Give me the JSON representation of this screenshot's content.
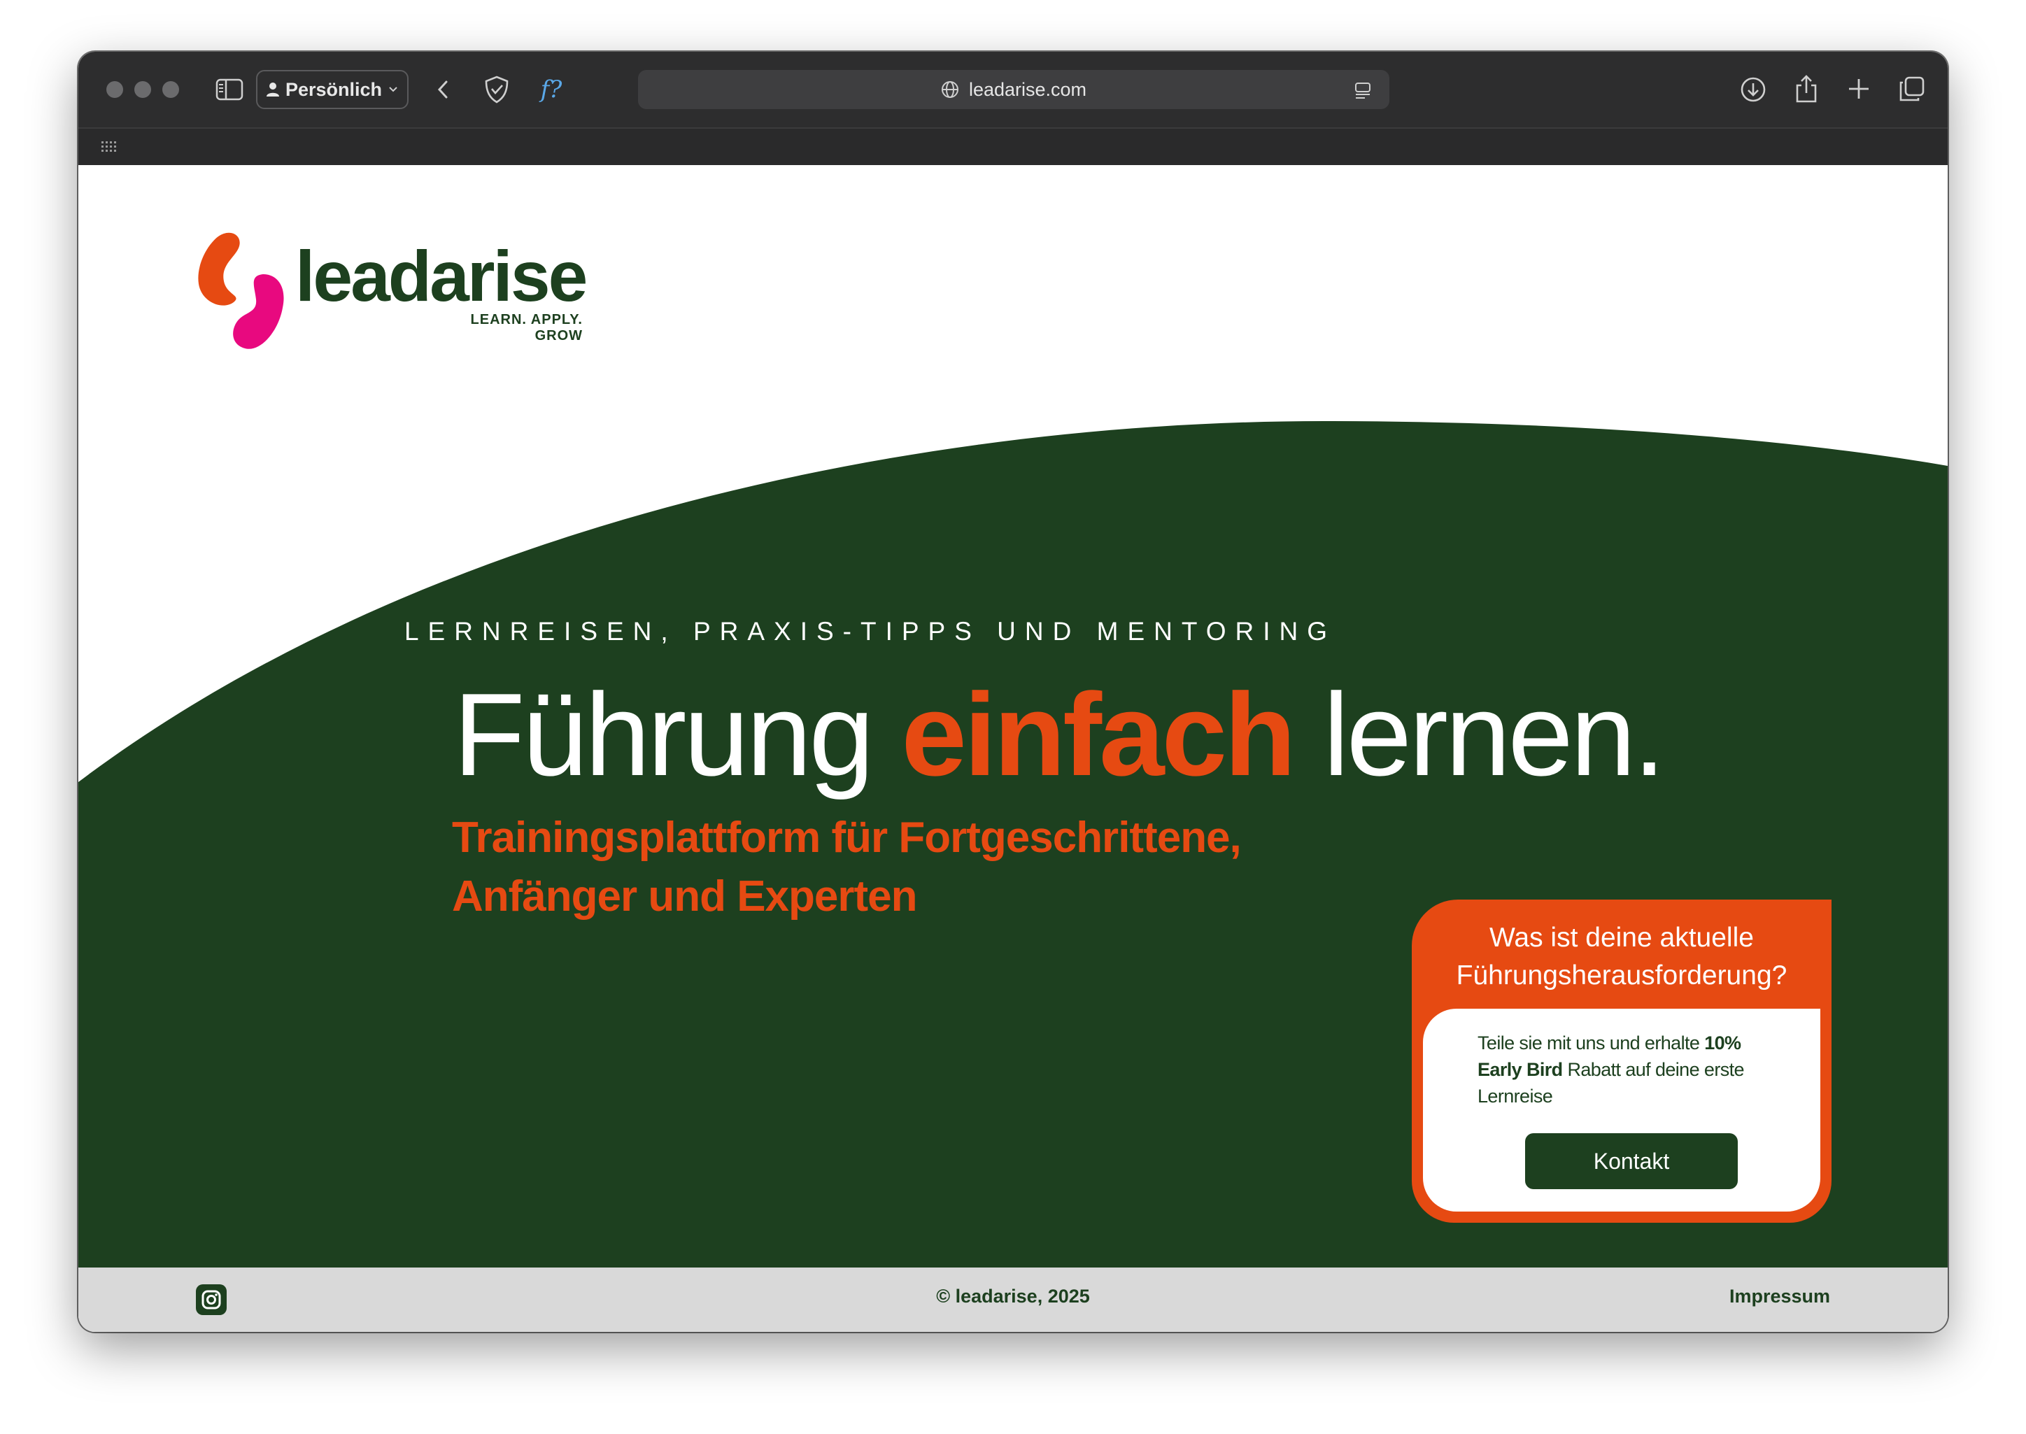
{
  "browser": {
    "profile_label": "Persönlich",
    "url": "leadarise.com",
    "formula_glyph": "f?"
  },
  "logo": {
    "wordmark": "leadarise",
    "tagline": "LEARN. APPLY. GROW"
  },
  "hero": {
    "eyebrow": "LERNREISEN, PRAXIS-TIPPS UND MENTORING",
    "headline_pre": "Führung ",
    "headline_accent": "einfach",
    "headline_post": " lernen.",
    "subline_1": "Trainingsplattform für Fortgeschrittene,",
    "subline_2": "Anfänger und Experten"
  },
  "cta": {
    "title_1": "Was ist deine aktuelle",
    "title_2": "Führungsherausforderung?",
    "text_1": "Teile sie mit uns und erhalte ",
    "text_bold": "10% Early Bird",
    "text_2": " Rabatt auf deine erste Lernreise",
    "button_label": "Kontakt"
  },
  "footer": {
    "copyright": "© leadarise, 2025",
    "impressum": "Impressum",
    "social_icon": "instagram-icon"
  },
  "colors": {
    "brand_green": "#1d401f",
    "accent_orange": "#e64a12",
    "logo_magenta": "#e8097f",
    "footer_bg": "#d9d9d9"
  }
}
